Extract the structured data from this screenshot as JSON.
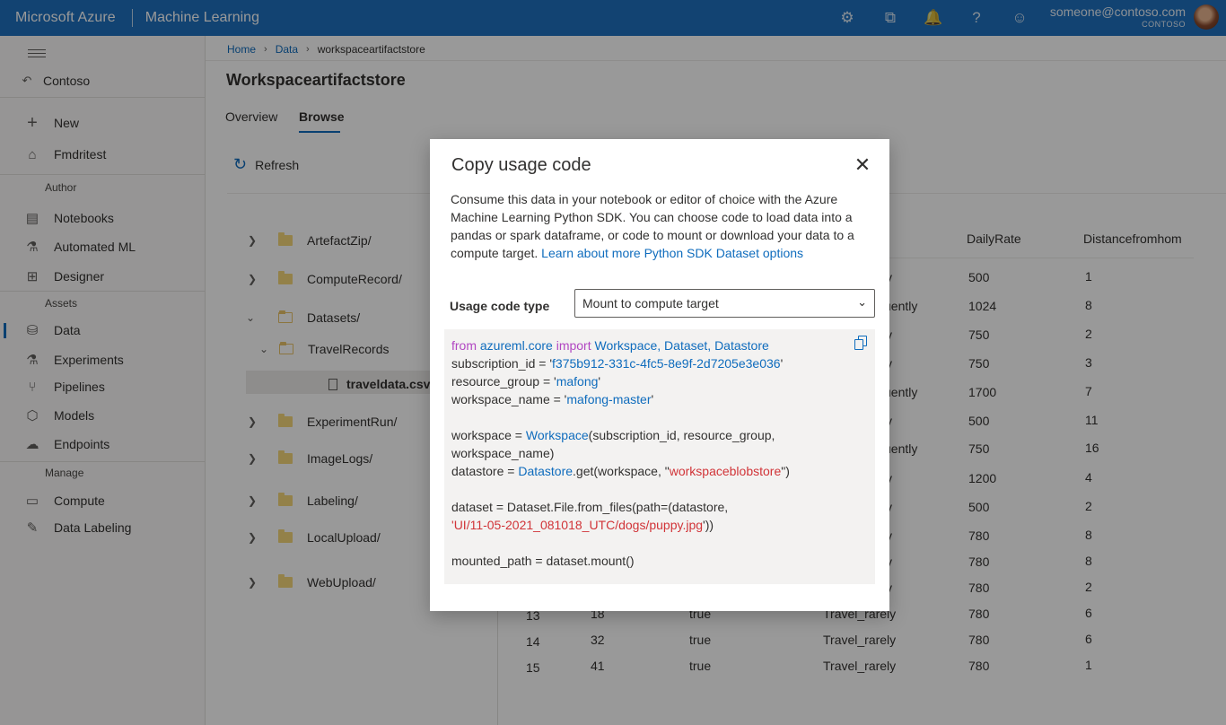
{
  "topbar": {
    "brand": "Microsoft Azure",
    "product": "Machine Learning",
    "icons": [
      "gear-icon",
      "feedback-icon",
      "bell-icon",
      "help-icon",
      "smiley-icon"
    ],
    "icon_glyphs": [
      "⚙",
      "⧉",
      "🔔",
      "?",
      "☺"
    ],
    "email": "someone@contoso.com",
    "org": "CONTOSO"
  },
  "sidebar": {
    "back": "Contoso",
    "items_top": [
      {
        "label": "New",
        "icon": "plus-icon",
        "glyph": "+"
      },
      {
        "label": "Fmdritest",
        "icon": "home-icon",
        "glyph": "⌂"
      }
    ],
    "sections": {
      "author": "Author",
      "assets": "Assets",
      "manage": "Manage"
    },
    "author_items": [
      {
        "label": "Notebooks",
        "icon": "notebook-icon",
        "glyph": "▤"
      },
      {
        "label": "Automated ML",
        "icon": "automl-icon",
        "glyph": "⚗"
      },
      {
        "label": "Designer",
        "icon": "designer-icon",
        "glyph": "⊞"
      }
    ],
    "asset_items": [
      {
        "label": "Data",
        "icon": "data-icon",
        "glyph": "⛁"
      },
      {
        "label": "Experiments",
        "icon": "flask-icon",
        "glyph": "⚗"
      },
      {
        "label": "Pipelines",
        "icon": "pipeline-icon",
        "glyph": "⑂"
      },
      {
        "label": "Models",
        "icon": "cube-icon",
        "glyph": "⬡"
      },
      {
        "label": "Endpoints",
        "icon": "cloud-icon",
        "glyph": "☁"
      }
    ],
    "manage_items": [
      {
        "label": "Compute",
        "icon": "monitor-icon",
        "glyph": "▭"
      },
      {
        "label": "Data Labeling",
        "icon": "edit-icon",
        "glyph": "✎"
      }
    ]
  },
  "breadcrumb": {
    "home": "Home",
    "data": "Data",
    "current": "workspaceartifactstore"
  },
  "page": {
    "title": "Workspaceartifactstore",
    "tabs": [
      "Overview",
      "Browse"
    ],
    "refresh": "Refresh"
  },
  "tree": {
    "folders": [
      "ArtefactZip/",
      "ComputeRecord/",
      "Datasets/",
      "TravelRecords",
      "ExperimentRun/",
      "ImageLogs/",
      "Labeling/",
      "LocalUpload/",
      "WebUpload/"
    ],
    "file": "traveldata.csv"
  },
  "grid": {
    "headers": {
      "daily_rate": "DailyRate",
      "distance": "Distancefromhom"
    },
    "travel_partial": [
      "y",
      "uently",
      "y",
      "y",
      "uently",
      "y",
      "uently",
      "y",
      "y",
      "y",
      "y",
      "y"
    ],
    "rates": [
      "500",
      "1024",
      "750",
      "750",
      "1700",
      "500",
      "750",
      "1200",
      "500",
      "780",
      "780",
      "780",
      "780",
      "780",
      "780"
    ],
    "distances": [
      "1",
      "8",
      "2",
      "3",
      "7",
      "11",
      "16",
      "4",
      "2",
      "8",
      "8",
      "2",
      "6",
      "6",
      "1"
    ],
    "visible_rows": [
      {
        "id": "13",
        "age": "18",
        "attr": "true",
        "travel": "Travel_rarely"
      },
      {
        "id": "14",
        "age": "32",
        "attr": "true",
        "travel": "Travel_rarely"
      },
      {
        "id": "15",
        "age": "41",
        "attr": "true",
        "travel": "Travel_rarely"
      }
    ]
  },
  "modal": {
    "title": "Copy usage code",
    "description": "Consume this data in your notebook or editor of choice with the Azure Machine Learning Python SDK. You can choose code to load data into a pandas or spark dataframe, or code to mount or download your data to a compute target.",
    "link": "Learn about more Python SDK Dataset options",
    "label": "Usage code type",
    "selected": "Mount to compute target",
    "code": {
      "l1_from": "from",
      "l1_mod": "azureml.core",
      "l1_import": "import",
      "l1_names": "Workspace, Dataset, Datastore",
      "l2_a": "subscription_id = '",
      "l2_b": "f375b912-331c-4fc5-8e9f-2d7205e3e036",
      "l2_c": "'",
      "l3_a": "resource_group = '",
      "l3_b": "mafong",
      "l3_c": "'",
      "l4_a": "workspace_name = '",
      "l4_b": "mafong-master",
      "l4_c": "'",
      "l6_a": "workspace = ",
      "l6_b": "Workspace",
      "l6_c": "(subscription_id, resource_group,",
      "l7": "workspace_name)",
      "l8_a": "datastore = ",
      "l8_b": "Datastore",
      "l8_c": ".get(workspace, \"",
      "l8_d": "workspaceblobstore",
      "l8_e": "\")",
      "l10": "dataset = Dataset.File.from_files(path=(datastore,",
      "l11_a": "'",
      "l11_b": "UI/11-05-2021_081018_UTC/dogs/puppy.jpg",
      "l11_c": "'))",
      "l13": "mounted_path = dataset.mount()"
    }
  }
}
